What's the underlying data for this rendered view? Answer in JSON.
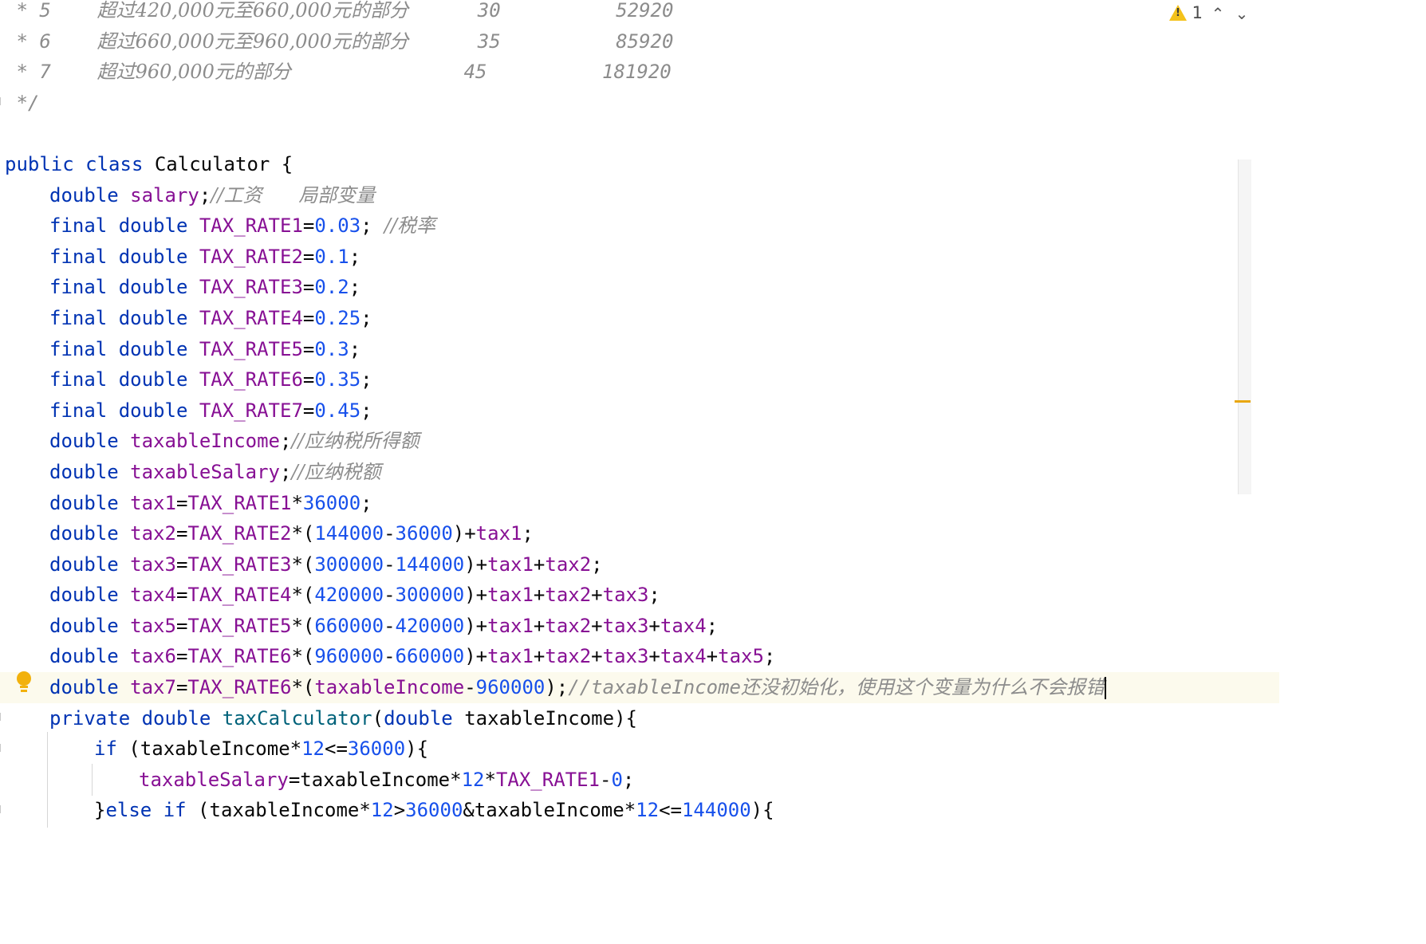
{
  "editor": {
    "comment_rows": [
      {
        "prefix": " * 5    ",
        "desc": "超过420,000元至660,000元的部分",
        "rate": "30",
        "deduction": "52920"
      },
      {
        "prefix": " * 6    ",
        "desc": "超过660,000元至960,000元的部分",
        "rate": "35",
        "deduction": "85920"
      },
      {
        "prefix": " * 7    ",
        "desc": "超过960,000元的部分",
        "rate": "45",
        "deduction": "181920"
      }
    ],
    "comment_end": " */",
    "class_decl": {
      "public": "public",
      "class": "class",
      "name": "Calculator",
      "brace": " {"
    },
    "salary": {
      "type": "double",
      "name": "salary",
      "comment": "//工资      局部变量"
    },
    "rates": [
      {
        "mod": "final",
        "type": "double",
        "name": "TAX_RATE1",
        "value": "0.03",
        "comment": "  //税率"
      },
      {
        "mod": "final",
        "type": "double",
        "name": "TAX_RATE2",
        "value": "0.1",
        "comment": ""
      },
      {
        "mod": "final",
        "type": "double",
        "name": "TAX_RATE3",
        "value": "0.2",
        "comment": ""
      },
      {
        "mod": "final",
        "type": "double",
        "name": "TAX_RATE4",
        "value": "0.25",
        "comment": ""
      },
      {
        "mod": "final",
        "type": "double",
        "name": "TAX_RATE5",
        "value": "0.3",
        "comment": ""
      },
      {
        "mod": "final",
        "type": "double",
        "name": "TAX_RATE6",
        "value": "0.35",
        "comment": ""
      },
      {
        "mod": "final",
        "type": "double",
        "name": "TAX_RATE7",
        "value": "0.45",
        "comment": ""
      }
    ],
    "taxable_income": {
      "type": "double",
      "name": "taxableIncome",
      "comment": "//应纳税所得额"
    },
    "taxable_salary": {
      "type": "double",
      "name": "taxableSalary",
      "comment": "//应纳税额"
    },
    "tax1": {
      "type": "double",
      "name": "tax1",
      "rate": "TAX_RATE1",
      "op": "*",
      "num": "36000"
    },
    "tax_lines": [
      {
        "type": "double",
        "name": "tax2",
        "rate": "TAX_RATE2",
        "a": "144000",
        "b": "36000",
        "adds": [
          "tax1"
        ]
      },
      {
        "type": "double",
        "name": "tax3",
        "rate": "TAX_RATE3",
        "a": "300000",
        "b": "144000",
        "adds": [
          "tax1",
          "tax2"
        ]
      },
      {
        "type": "double",
        "name": "tax4",
        "rate": "TAX_RATE4",
        "a": "420000",
        "b": "300000",
        "adds": [
          "tax1",
          "tax2",
          "tax3"
        ]
      },
      {
        "type": "double",
        "name": "tax5",
        "rate": "TAX_RATE5",
        "a": "660000",
        "b": "420000",
        "adds": [
          "tax1",
          "tax2",
          "tax3",
          "tax4"
        ]
      },
      {
        "type": "double",
        "name": "tax6",
        "rate": "TAX_RATE6",
        "a": "960000",
        "b": "660000",
        "adds": [
          "tax1",
          "tax2",
          "tax3",
          "tax4",
          "tax5"
        ]
      }
    ],
    "tax7": {
      "type": "double",
      "name": "tax7",
      "rate": "TAX_RATE6",
      "ref": "taxableIncome",
      "num": "960000",
      "comment_code": "//taxableIncome",
      "comment_text": "还没初始化，使用这个变量为什么不会报错"
    },
    "method_decl": {
      "mod": "private",
      "type": "double",
      "name": "taxCalculator",
      "ptype": "double",
      "pname": "taxableIncome",
      "tail": "){"
    },
    "if1": {
      "kw": "if",
      "open": " (taxableIncome*",
      "n1": "12",
      "op": "<=",
      "n2": "36000",
      "close": "){"
    },
    "assign1": {
      "field": "taxableSalary",
      "expr": "=taxableIncome*",
      "n1": "12",
      "mul": "*",
      "rate": "TAX_RATE1",
      "minus": "-",
      "n2": "0",
      "end": ";"
    },
    "elseif": {
      "brace": "}",
      "kw1": "else",
      "kw2": "if",
      "open": " (taxableIncome*",
      "n1": "12",
      "gt": ">",
      "n2": "36000",
      "amp": "&taxableIncome*",
      "n3": "12",
      "le": "<=",
      "n4": "144000",
      "close": "){"
    }
  },
  "inspections": {
    "icon": "warning-triangle-icon",
    "count": "1",
    "up": "⌃",
    "down": "⌄"
  },
  "colors": {
    "keyword": "#0033b3",
    "field": "#871094",
    "number": "#1750eb",
    "method": "#00627a",
    "comment": "#8c8c8c",
    "current_line": "#fcfaed",
    "warning": "#f4c21b"
  }
}
